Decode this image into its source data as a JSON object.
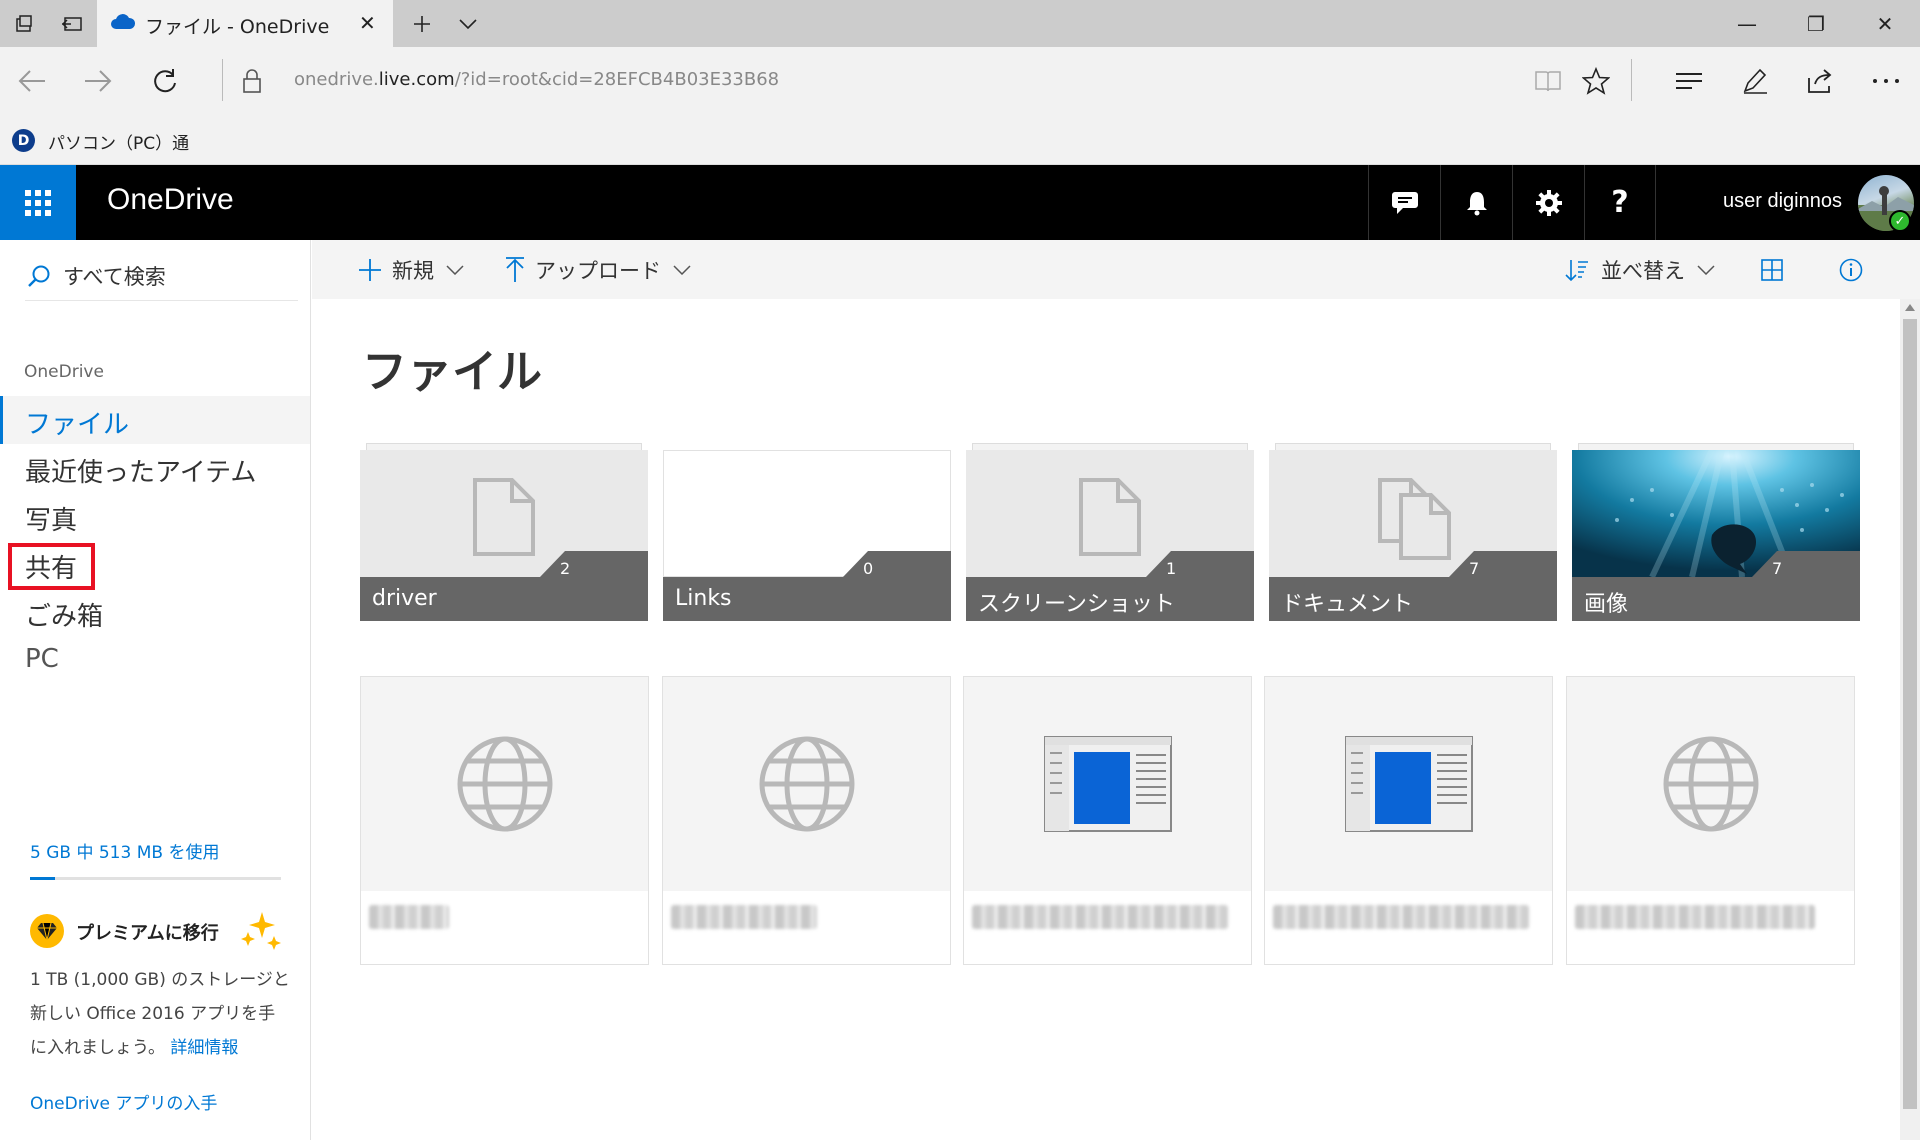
{
  "browser": {
    "tab_title": "ファイル - OneDrive",
    "url_prefix": "onedrive.",
    "url_domain": "live.com",
    "url_rest": "/?id=root&cid=28EFCB4B03E33B68",
    "favorites": [
      {
        "label": "パソコン（PC）通",
        "icon": "pc-tsu-icon"
      }
    ],
    "window_controls": {
      "minimize": "—",
      "restore": "❐",
      "close": "✕"
    }
  },
  "header": {
    "app_name": "OneDrive",
    "user_name": "user diginnos",
    "icons": [
      "chat-icon",
      "bell-icon",
      "gear-icon",
      "help-icon"
    ],
    "help_label": "?"
  },
  "sidebar": {
    "search_label": "すべて検索",
    "section_heading": "OneDrive",
    "items": [
      {
        "label": "ファイル",
        "active": true
      },
      {
        "label": "最近使ったアイテム",
        "active": false
      },
      {
        "label": "写真",
        "active": false
      },
      {
        "label": "共有",
        "active": false,
        "highlighted": true
      },
      {
        "label": "ごみ箱",
        "active": false
      },
      {
        "label": "PC",
        "active": false
      }
    ],
    "quota_text": "5 GB 中 513 MB を使用",
    "quota_used_fraction": 0.1,
    "premium_title": "プレミアムに移行",
    "premium_desc": "1 TB (1,000 GB) のストレージと新しい Office 2016 アプリを手に入れましょう。",
    "premium_link": "詳細情報",
    "get_app": "OneDrive アプリの入手"
  },
  "commands": {
    "new_label": "新規",
    "upload_label": "アップロード",
    "sort_label": "並べ替え"
  },
  "main": {
    "title": "ファイル",
    "folders": [
      {
        "name": "driver",
        "count": "2",
        "thumb": "document-icon"
      },
      {
        "name": "Links",
        "count": "0",
        "thumb": "empty"
      },
      {
        "name": "スクリーンショット",
        "count": "1",
        "thumb": "document-icon"
      },
      {
        "name": "ドキュメント",
        "count": "7",
        "thumb": "documents-icon"
      },
      {
        "name": "画像",
        "count": "7",
        "thumb": "underwater-photo"
      }
    ],
    "files": [
      {
        "thumb": "globe-icon"
      },
      {
        "thumb": "globe-icon"
      },
      {
        "thumb": "app-window-icon"
      },
      {
        "thumb": "app-window-icon"
      },
      {
        "thumb": "globe-icon"
      }
    ]
  },
  "colors": {
    "accent": "#0078d4",
    "header_bg": "#000000",
    "label_bar": "#666666",
    "highlight": "#e81123"
  }
}
